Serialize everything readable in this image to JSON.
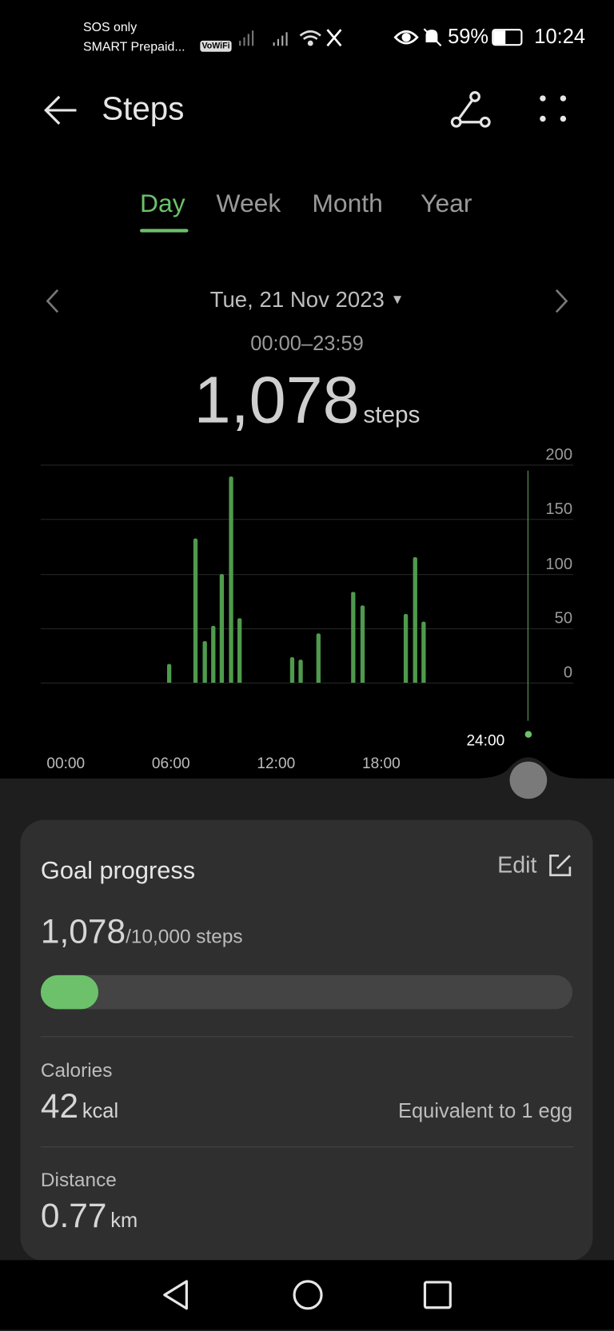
{
  "status_bar": {
    "carrier_line1": "SOS only",
    "carrier_line2": "SMART Prepaid...",
    "vowifi": "VoWiFi",
    "battery": "59%",
    "time": "10:24",
    "icons": [
      "signal-icon",
      "wifi-icon",
      "x-app-icon",
      "eye-icon",
      "bell-off-icon",
      "battery-icon"
    ]
  },
  "header": {
    "title": "Steps",
    "icons": [
      "back-arrow-icon",
      "share-icon",
      "more-icon"
    ]
  },
  "tabs": [
    {
      "label": "Day",
      "active": true
    },
    {
      "label": "Week"
    },
    {
      "label": "Month"
    },
    {
      "label": "Year"
    }
  ],
  "date": {
    "label": "Tue, 21 Nov 2023",
    "range": "00:00–23:59"
  },
  "total": {
    "value": "1,078",
    "unit": "steps"
  },
  "accent": "#6cc16a",
  "chart_data": {
    "type": "bar",
    "ylim": [
      0,
      200
    ],
    "yticks": [
      "200",
      "150",
      "100",
      "50",
      "0"
    ],
    "xticks": [
      "00:00",
      "06:00",
      "12:00",
      "18:00"
    ],
    "cursor_label": "24:00",
    "x": [
      "07:00",
      "08:30",
      "09:00",
      "09:30",
      "10:00",
      "10:30",
      "11:00",
      "14:00",
      "14:30",
      "15:30",
      "17:30",
      "18:00",
      "20:30",
      "21:00",
      "21:30"
    ],
    "values": [
      17,
      132,
      38,
      52,
      100,
      189,
      59,
      23,
      21,
      45,
      83,
      71,
      63,
      115,
      56
    ],
    "grid": true
  },
  "goal": {
    "title": "Goal progress",
    "edit": "Edit",
    "current": "1,078",
    "target": "/10,000 steps",
    "progress": 0.108
  },
  "calories": {
    "label": "Calories",
    "value": "42",
    "unit": "kcal",
    "equivalent": "Equivalent to 1 egg"
  },
  "distance": {
    "label": "Distance",
    "value": "0.77",
    "unit": "km"
  },
  "nav": [
    "back-icon",
    "home-icon",
    "recents-icon"
  ]
}
